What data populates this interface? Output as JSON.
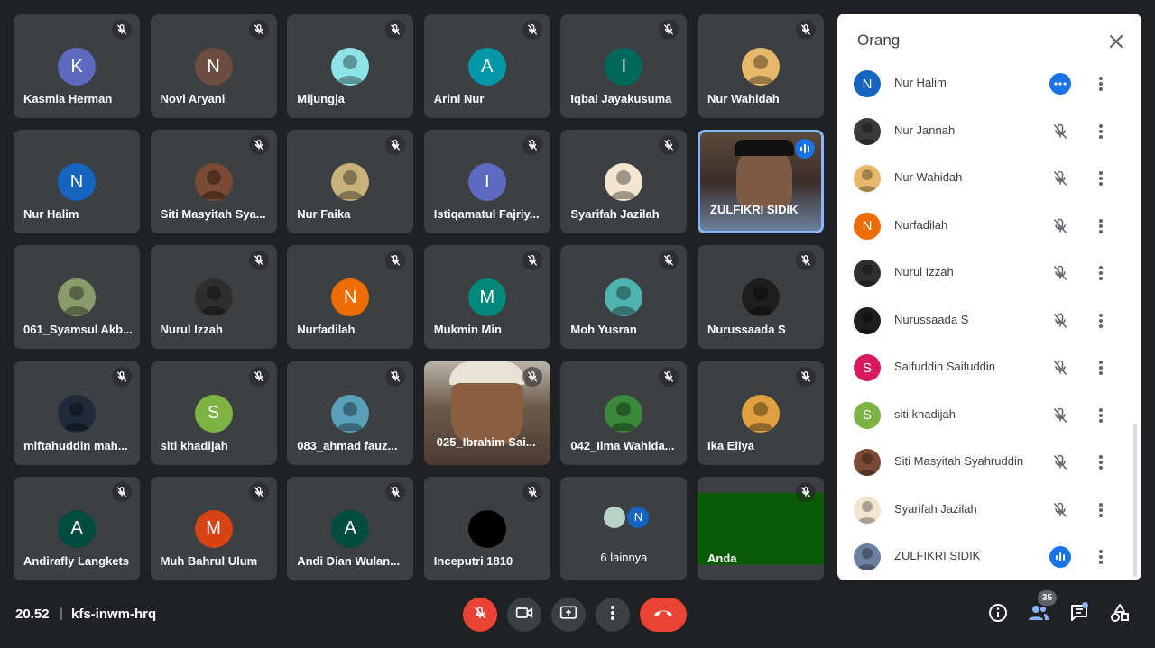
{
  "tiles": [
    {
      "name": "Kasmia Herman",
      "initial": "K",
      "color": "#5c6bc0",
      "avatar": "letter",
      "muted": true
    },
    {
      "name": "Novi Aryani",
      "initial": "N",
      "color": "#6d4c41",
      "avatar": "letter",
      "muted": true
    },
    {
      "name": "Mijungja",
      "initial": "",
      "color": "#8ee3e8",
      "avatar": "photo",
      "muted": true
    },
    {
      "name": "Arini Nur",
      "initial": "A",
      "color": "#0097a7",
      "avatar": "letter",
      "muted": true
    },
    {
      "name": "Iqbal Jayakusuma",
      "initial": "I",
      "color": "#00695c",
      "avatar": "letter",
      "muted": true
    },
    {
      "name": "Nur Wahidah",
      "initial": "",
      "color": "#e8b86a",
      "avatar": "photo",
      "muted": true
    },
    {
      "name": "Nur Halim",
      "initial": "N",
      "color": "#1565c0",
      "avatar": "letter",
      "muted": false
    },
    {
      "name": "Siti Masyitah Sya...",
      "initial": "",
      "color": "#7a4a34",
      "avatar": "photo",
      "muted": true
    },
    {
      "name": "Nur Faika",
      "initial": "",
      "color": "#c8b27a",
      "avatar": "photo",
      "muted": true
    },
    {
      "name": "Istiqamatul Fajriy...",
      "initial": "I",
      "color": "#5c6bc0",
      "avatar": "letter",
      "muted": true
    },
    {
      "name": "Syarifah Jazilah",
      "initial": "",
      "color": "#f2e6d0",
      "avatar": "photo",
      "muted": true
    },
    {
      "name": "ZULFIKRI SIDIK",
      "initial": "",
      "color": "",
      "avatar": "video",
      "muted": false,
      "speaking": true
    },
    {
      "name": "061_Syamsul Akb...",
      "initial": "",
      "color": "#8a9a6a",
      "avatar": "photo",
      "muted": false
    },
    {
      "name": "Nurul Izzah",
      "initial": "",
      "color": "#2e2e2e",
      "avatar": "photo",
      "muted": true
    },
    {
      "name": "Nurfadilah",
      "initial": "N",
      "color": "#ef6c00",
      "avatar": "letter",
      "muted": true
    },
    {
      "name": "Mukmin Min",
      "initial": "M",
      "color": "#00897b",
      "avatar": "letter",
      "muted": true
    },
    {
      "name": "Moh Yusran",
      "initial": "",
      "color": "#4fb3b0",
      "avatar": "photo",
      "muted": true
    },
    {
      "name": "Nurussaada S",
      "initial": "",
      "color": "#1e1e1e",
      "avatar": "photo",
      "muted": true
    },
    {
      "name": "miftahuddin mah...",
      "initial": "",
      "color": "#1f2a3a",
      "avatar": "photo",
      "muted": true
    },
    {
      "name": "siti khadijah",
      "initial": "S",
      "color": "#7cb342",
      "avatar": "letter",
      "muted": true
    },
    {
      "name": "083_ahmad fauz...",
      "initial": "",
      "color": "#5aa0b8",
      "avatar": "photo",
      "muted": true
    },
    {
      "name": "025_Ibrahim Sai...",
      "initial": "",
      "color": "",
      "avatar": "video2",
      "muted": true
    },
    {
      "name": "042_Ilma Wahida...",
      "initial": "",
      "color": "#3a8a3a",
      "avatar": "photo",
      "muted": true
    },
    {
      "name": "Ika Eliya",
      "initial": "",
      "color": "#e0a040",
      "avatar": "photo",
      "muted": true
    },
    {
      "name": "Andirafly Langkets",
      "initial": "A",
      "color": "#004d40",
      "avatar": "letter",
      "muted": true
    },
    {
      "name": "Muh Bahrul Ulum",
      "initial": "M",
      "color": "#d84315",
      "avatar": "letter",
      "muted": true
    },
    {
      "name": "Andi Dian Wulan...",
      "initial": "A",
      "color": "#004d40",
      "avatar": "letter",
      "muted": true
    },
    {
      "name": "Inceputri 1810",
      "initial": "",
      "color": "#000000",
      "avatar": "letter",
      "muted": true
    },
    {
      "name": "",
      "initial": "",
      "color": "",
      "avatar": "more",
      "muted": false
    },
    {
      "name": "Anda",
      "initial": "",
      "color": "",
      "avatar": "self",
      "muted": true
    }
  ],
  "more_tile": {
    "label": "6 lainnya",
    "initial": "N"
  },
  "panel": {
    "title": "Orang",
    "people": [
      {
        "name": "Nur Halim",
        "initial": "N",
        "color": "#1565c0",
        "state": "more"
      },
      {
        "name": "Nur Jannah",
        "initial": "",
        "color": "#3a3a3a",
        "state": "muted"
      },
      {
        "name": "Nur Wahidah",
        "initial": "",
        "color": "#e8b86a",
        "state": "muted"
      },
      {
        "name": "Nurfadilah",
        "initial": "N",
        "color": "#ef6c00",
        "state": "muted"
      },
      {
        "name": "Nurul Izzah",
        "initial": "",
        "color": "#2e2e2e",
        "state": "muted"
      },
      {
        "name": "Nurussaada S",
        "initial": "",
        "color": "#1e1e1e",
        "state": "muted"
      },
      {
        "name": "Saifuddin Saifuddin",
        "initial": "S",
        "color": "#d81b60",
        "state": "muted"
      },
      {
        "name": "siti khadijah",
        "initial": "S",
        "color": "#7cb342",
        "state": "muted"
      },
      {
        "name": "Siti Masyitah Syahruddin",
        "initial": "",
        "color": "#7a4a34",
        "state": "muted"
      },
      {
        "name": "Syarifah Jazilah",
        "initial": "",
        "color": "#f2e6d0",
        "state": "muted"
      },
      {
        "name": "ZULFIKRI SIDIK",
        "initial": "",
        "color": "#6b7f9e",
        "state": "speaking"
      }
    ]
  },
  "bottom": {
    "time": "20.52",
    "separator": "|",
    "meeting_code": "kfs-inwm-hrq",
    "participant_count": "35"
  }
}
